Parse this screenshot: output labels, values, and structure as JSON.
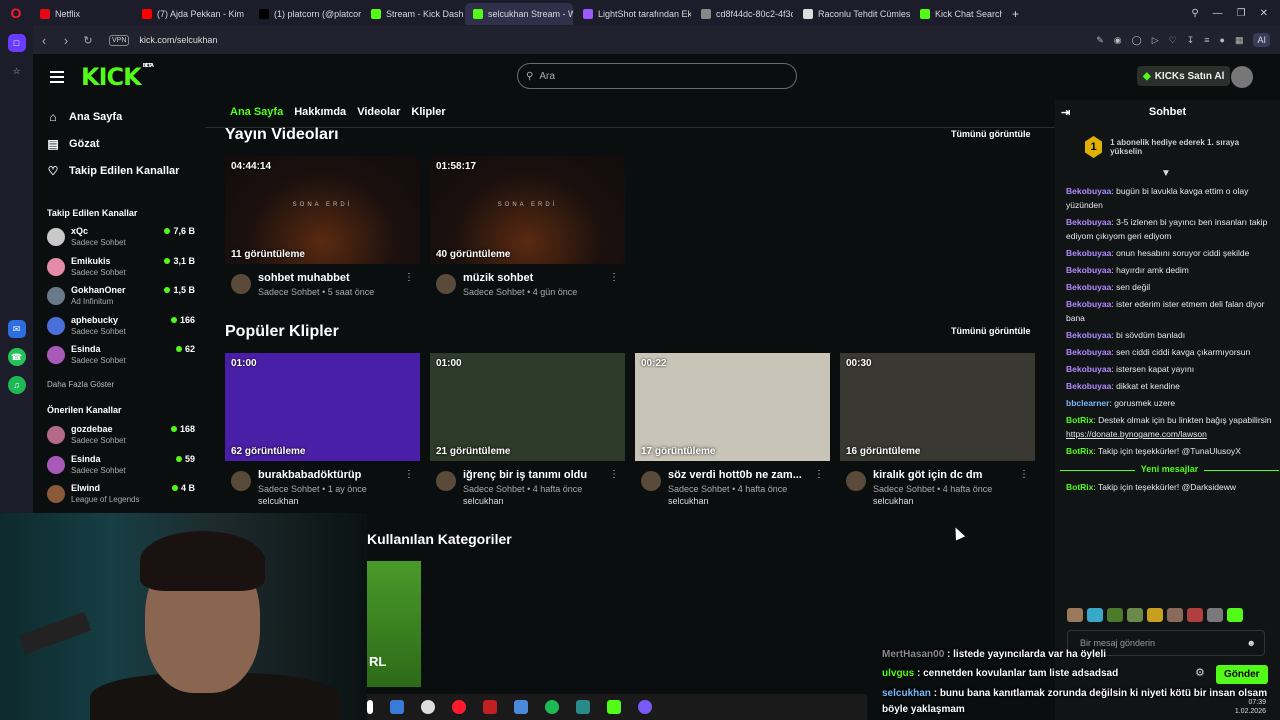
{
  "browser": {
    "tabs": [
      {
        "label": "Netflix",
        "color": "#e50914"
      },
      {
        "label": "(7) Ajda Pekkan - Kim",
        "color": "#ff0000"
      },
      {
        "label": "(1) platcorn (@platcornw",
        "color": "#000000"
      },
      {
        "label": "Stream - Kick Dashboard",
        "color": "#53fc18"
      },
      {
        "label": "selcukhan Stream - Watch",
        "color": "#53fc18"
      },
      {
        "label": "LightShot tarafından Ekran",
        "color": "#9b59ff"
      },
      {
        "label": "cd8f44dc-80c2-4f3c-a3cc",
        "color": "#888888"
      },
      {
        "label": "Raconlu Tehdit Cümlesi",
        "color": "#dddddd"
      },
      {
        "label": "Kick Chat Search",
        "color": "#53fc18"
      }
    ],
    "vpn_label": "VPN",
    "url": "kick.com/selcukhan",
    "ai_label": "AI"
  },
  "header": {
    "logo_text": "KICK",
    "logo_beta": "BETA",
    "search_placeholder": "Ara",
    "buy_button": "KICKs Satın Al"
  },
  "sidebar": {
    "menu": [
      {
        "label": "Ana Sayfa",
        "icon": "home-icon"
      },
      {
        "label": "Gözat",
        "icon": "browse-icon"
      },
      {
        "label": "Takip Edilen Kanallar",
        "icon": "heart-icon"
      }
    ],
    "followed_title": "Takip Edilen Kanallar",
    "followed": [
      {
        "name": "xQc",
        "category": "Sadece Sohbet",
        "viewers": "7,6 B",
        "color": "#c9c9c9"
      },
      {
        "name": "Emikukis",
        "category": "Sadece Sohbet",
        "viewers": "3,1 B",
        "color": "#e58aa8"
      },
      {
        "name": "GokhanOner",
        "category": "Ad Infinitum",
        "viewers": "1,5 B",
        "color": "#6a7a8a"
      },
      {
        "name": "aphebucky",
        "category": "Sadece Sohbet",
        "viewers": "166",
        "color": "#4a6fd8"
      },
      {
        "name": "Esinda",
        "category": "Sadece Sohbet",
        "viewers": "62",
        "color": "#a85ab8"
      }
    ],
    "show_more": "Daha Fazla Göster",
    "recommended_title": "Önerilen Kanallar",
    "recommended": [
      {
        "name": "gozdebae",
        "category": "Sadece Sohbet",
        "viewers": "168",
        "color": "#b46a8a"
      },
      {
        "name": "Esinda",
        "category": "Sadece Sohbet",
        "viewers": "59",
        "color": "#a85ab8"
      },
      {
        "name": "Elwind",
        "category": "League of Legends",
        "viewers": "4 B",
        "color": "#8a5a3a"
      }
    ]
  },
  "main": {
    "tabs": [
      "Ana Sayfa",
      "Hakkımda",
      "Videolar",
      "Klipler"
    ],
    "videos_title": "Yayın Videoları",
    "see_all": "Tümünü görüntüle",
    "videos": [
      {
        "duration": "04:44:14",
        "views": "11 görüntüleme",
        "title": "sohbet muhabbet",
        "category": "Sadece Sohbet",
        "age": "5 saat önce",
        "overlay": "SONA ERDİ"
      },
      {
        "duration": "01:58:17",
        "views": "40 görüntüleme",
        "title": "müzik sohbet",
        "category": "Sadece Sohbet",
        "age": "4 gün önce",
        "overlay": "SONA ERDİ"
      }
    ],
    "clips_title": "Popüler Klipler",
    "clips": [
      {
        "duration": "01:00",
        "views": "62 görüntüleme",
        "title": "burakbabadöktürüp",
        "category": "Sadece Sohbet",
        "age": "1 ay önce",
        "author": "selcukhan",
        "bg": "#4a1fa8"
      },
      {
        "duration": "01:00",
        "views": "21 görüntüleme",
        "title": "iğrenç bir iş tanımı oldu",
        "category": "Sadece Sohbet",
        "age": "4 hafta önce",
        "author": "selcukhan",
        "bg": "#2e3a2a"
      },
      {
        "duration": "00:22",
        "views": "17 görüntüleme",
        "title": "söz verdi hott0b ne zam...",
        "category": "Sadece Sohbet",
        "age": "4 hafta önce",
        "author": "selcukhan",
        "bg": "#c8c4b8"
      },
      {
        "duration": "00:30",
        "views": "16 görüntüleme",
        "title": "kiralık göt için dc dm",
        "category": "Sadece Sohbet",
        "age": "4 hafta önce",
        "author": "selcukhan",
        "bg": "#3a3833"
      }
    ],
    "categories_title": "Kullanılan Kategoriler",
    "category_card_text": "RL"
  },
  "chat": {
    "title": "Sohbet",
    "pinned_badge": "1",
    "pinned_text": "1 abonelik hediye ederek 1. sıraya yükselin",
    "messages": [
      {
        "user": "Bekobuyaa",
        "text": "bugün bi lavukla kavga ettim o olay yüzünden",
        "color": "#b18aff"
      },
      {
        "user": "Bekobuyaa",
        "text": "3-5 izlenen bi yayıncı ben insanları takip ediyom çıkıyom geri ediyom",
        "color": "#b18aff"
      },
      {
        "user": "Bekobuyaa",
        "text": "onun hesabını soruyor ciddi şekilde",
        "color": "#b18aff"
      },
      {
        "user": "Bekobuyaa",
        "text": "hayırdır amk dedim",
        "color": "#b18aff"
      },
      {
        "user": "Bekobuyaa",
        "text": "sen değil",
        "color": "#b18aff"
      },
      {
        "user": "Bekobuyaa",
        "text": "ister ederim ister etmem deli falan diyor bana",
        "color": "#b18aff"
      },
      {
        "user": "Bekobuyaa",
        "text": "bi sövdüm banladı",
        "color": "#b18aff"
      },
      {
        "user": "Bekobuyaa",
        "text": "sen ciddi ciddi kavga çıkarmıyorsun",
        "color": "#b18aff"
      },
      {
        "user": "Bekobuyaa",
        "text": "istersen kapat yayını",
        "color": "#b18aff"
      },
      {
        "user": "Bekobuyaa",
        "text": "dikkat et kendine",
        "color": "#b18aff"
      },
      {
        "user": "bbclearner",
        "text": "gorusmek uzere",
        "color": "#7ab8ff"
      }
    ],
    "bot_messages": [
      {
        "user": "BotRix",
        "text": "Destek olmak için bu linkten bağış yapabilirsin",
        "link": "https://donate.bynogame.com/lawson",
        "color": "#53fc18"
      },
      {
        "user": "BotRix",
        "text": "Takip için teşekkürler! @TunaUlusoyX",
        "color": "#53fc18"
      }
    ],
    "new_messages": "Yeni mesajlar",
    "after_messages": [
      {
        "user": "BotRix",
        "text": "Takip için teşekkürler! @Darksideww",
        "color": "#53fc18"
      }
    ],
    "input_placeholder": "Bir mesaj gönderin",
    "send_label": "Gönder"
  },
  "overlay_chat": [
    {
      "user": "MertHasan00",
      "text": "listede yayıncılarda var ha öyleli",
      "color": "#8a8a8a"
    },
    {
      "user": "ulvgus",
      "text": "cennetden kovulanlar tam liste adsadsad",
      "color": "#53fc18"
    },
    {
      "user": "selcukhan",
      "text": "bunu bana kanıtlamak zorunda değilsin ki niyeti kötü bir insan olsam",
      "color": "#7ab8ff"
    },
    {
      "user": "",
      "text": "böyle yaklaşmam",
      "color": "#ffffff"
    }
  ],
  "tray": {
    "time": "07:39",
    "date": "1.02.2026"
  }
}
